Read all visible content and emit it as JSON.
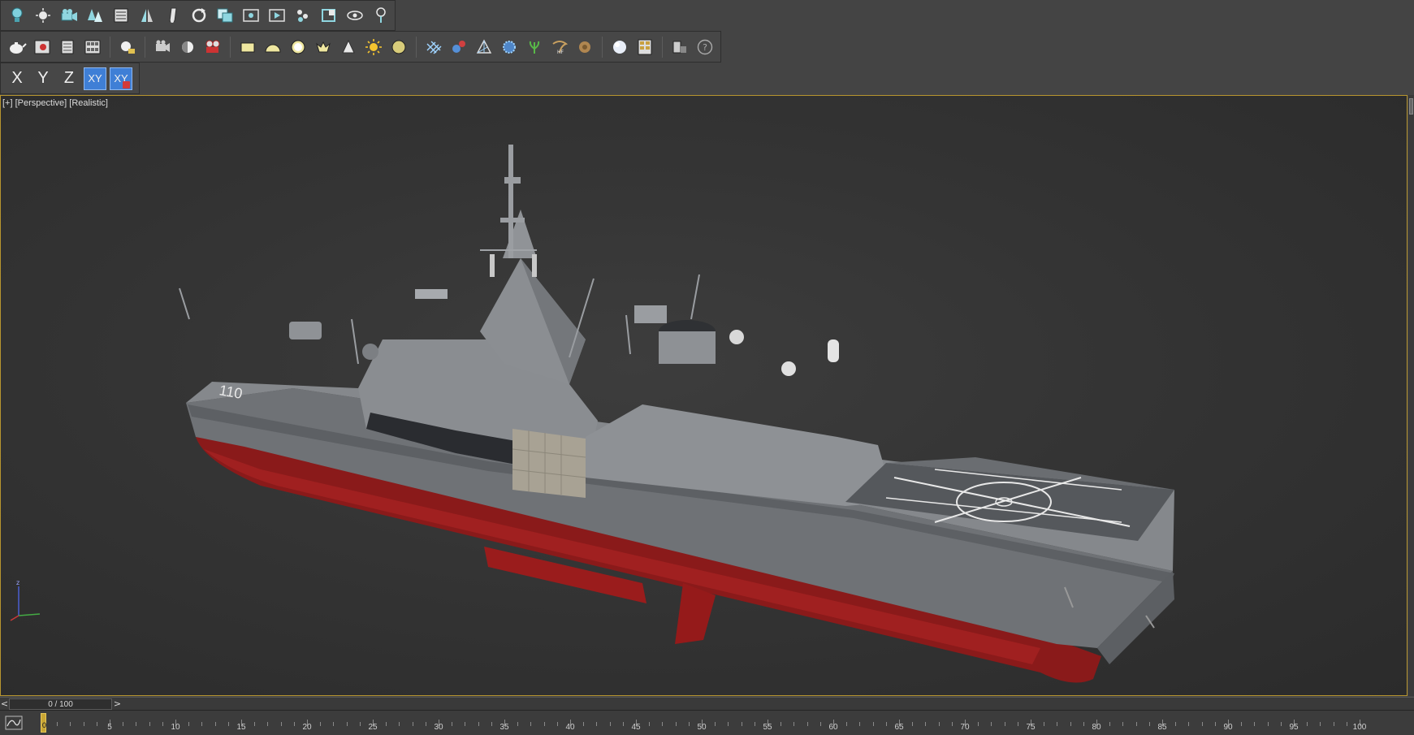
{
  "toolbar_row1": {
    "icons": [
      "light-bulb-icon",
      "sun-star-icon",
      "camera-group-icon",
      "trees-icon",
      "list-panel-icon",
      "mirror-icon",
      "bone-icon",
      "rotate-icon",
      "copy-layer-icon",
      "fit-icon",
      "play-icon",
      "filter-icon",
      "box-select-icon",
      "eye-icon",
      "light-target-icon"
    ]
  },
  "toolbar_row2": {
    "icons": [
      "teapot-icon",
      "render-frame-icon",
      "render-setup-icon",
      "material-editor-icon",
      "sphere-light-icon",
      "camera-icon",
      "half-sphere-icon",
      "film-camera-icon",
      "plane-icon",
      "dome-icon",
      "disc-icon",
      "crown-icon",
      "cone-icon",
      "sun-icon",
      "sphere-ball-icon",
      "lattice-icon",
      "molecule-icon",
      "pyramid-icon",
      "gear-sphere-icon",
      "plant-icon",
      "hair-icon",
      "shell-icon",
      "white-sphere-icon",
      "map-browser-icon",
      "export-icon",
      "help-icon"
    ]
  },
  "axis_constraints": {
    "x_label": "X",
    "y_label": "Y",
    "z_label": "Z",
    "xy_label": "XY",
    "xy_snap_label": "XY"
  },
  "viewport": {
    "plus_label": "[+]",
    "view_label": "[Perspective]",
    "shading_label": "[Realistic]",
    "hull_number": "110",
    "accent_border": "#b7952f"
  },
  "time_slider": {
    "frame_display": "0 / 100",
    "prev_label": "<",
    "next_label": ">"
  },
  "trackbar": {
    "current_frame": "0",
    "labels": [
      "5",
      "10",
      "15",
      "20",
      "25",
      "30",
      "35",
      "40",
      "45",
      "50",
      "55",
      "60",
      "65",
      "70",
      "75",
      "80",
      "85",
      "90",
      "95",
      "100"
    ]
  }
}
